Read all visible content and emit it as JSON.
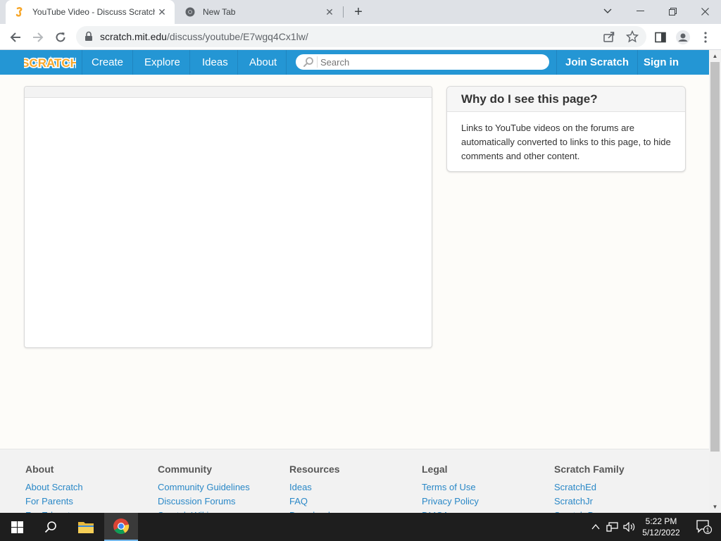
{
  "browser": {
    "tabs": [
      {
        "title": "YouTube Video - Discuss Scratch",
        "active": true
      },
      {
        "title": "New Tab",
        "active": false
      }
    ],
    "url_host": "scratch.mit.edu",
    "url_path": "/discuss/youtube/E7wgq4Cx1lw/"
  },
  "nav": {
    "logo_text": "SCRATCH",
    "items": [
      "Create",
      "Explore",
      "Ideas",
      "About"
    ],
    "search_placeholder": "Search",
    "join_label": "Join Scratch",
    "signin_label": "Sign in"
  },
  "why": {
    "title": "Why do I see this page?",
    "body": "Links to YouTube videos on the forums are automatically converted to links to this page, to hide comments and other content."
  },
  "footer": {
    "columns": [
      {
        "heading": "About",
        "links": [
          "About Scratch",
          "For Parents",
          "For Educators"
        ]
      },
      {
        "heading": "Community",
        "links": [
          "Community Guidelines",
          "Discussion Forums",
          "Scratch Wiki"
        ]
      },
      {
        "heading": "Resources",
        "links": [
          "Ideas",
          "FAQ",
          "Download"
        ]
      },
      {
        "heading": "Legal",
        "links": [
          "Terms of Use",
          "Privacy Policy",
          "DMCA"
        ]
      },
      {
        "heading": "Scratch Family",
        "links": [
          "ScratchEd",
          "ScratchJr",
          "Scratch Day"
        ]
      }
    ]
  },
  "taskbar": {
    "time": "5:22 PM",
    "date": "5/12/2022",
    "notification_count": "1"
  },
  "colors": {
    "scratch_blue": "#2496d4",
    "link": "#2a88c7",
    "scratch_orange": "#f7a72a"
  }
}
